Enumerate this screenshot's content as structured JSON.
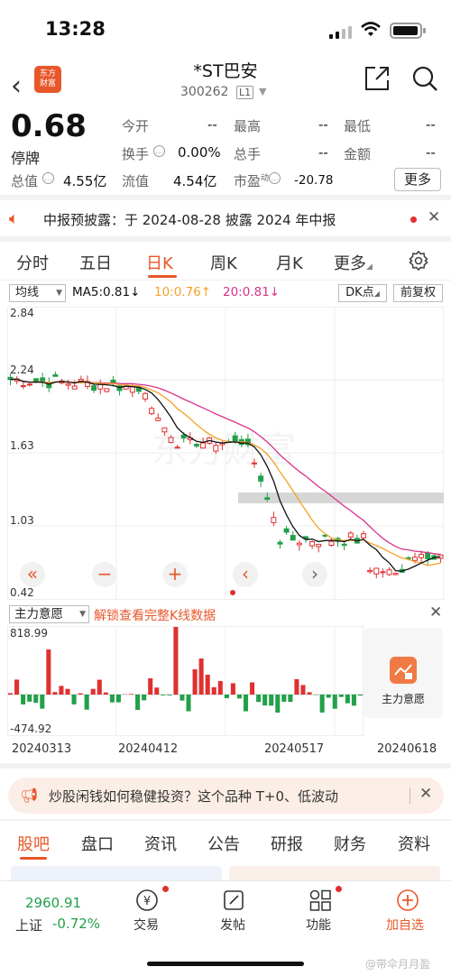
{
  "status": {
    "time": "13:28"
  },
  "header": {
    "logo": "东方\n财富",
    "title": "*ST巴安",
    "code": "300262",
    "level": "L1"
  },
  "quote": {
    "price": "0.68",
    "state": "停牌",
    "open_label": "今开",
    "open": "--",
    "high_label": "最高",
    "high": "--",
    "low_label": "最低",
    "low": "--",
    "turnover_label": "换手",
    "turnover": "0.00%",
    "volume_label": "总手",
    "volume": "--",
    "amount_label": "金额",
    "amount": "--",
    "mktcap_label": "总值",
    "mktcap": "4.55亿",
    "float_label": "流值",
    "float_cap": "4.54亿",
    "pe_label": "市盈",
    "pe_sup": "动",
    "pe": "-20.78",
    "more": "更多"
  },
  "notice": {
    "text": "中报预披露：于 2024-08-28 披露 2024 年中报"
  },
  "period_tabs": [
    "分时",
    "五日",
    "日K",
    "周K",
    "月K",
    "更多"
  ],
  "indicators": {
    "selector": "均线",
    "ma5": "MA5:0.81↓",
    "ma10": "10:0.76↑",
    "ma20": "20:0.81↓",
    "dk": "DK点",
    "adjust": "前复权",
    "colors": {
      "ma5": "#111111",
      "ma10": "#f2a227",
      "ma20": "#d9338c",
      "up": "#e03030",
      "down": "#22a04a"
    }
  },
  "price_axis": {
    "top": "2.84",
    "mid1": "2.24",
    "mid2": "1.63",
    "mid3": "1.03",
    "bottom": "0.42"
  },
  "chart_controls": [
    "«",
    "−",
    "+",
    "‹",
    "›"
  ],
  "mainforce": {
    "selector": "主力意愿",
    "unlock_link": "解锁查看完整K线数据",
    "axis_top": "818.99",
    "axis_bottom": "-474.92",
    "card_label": "主力意愿"
  },
  "dates": [
    "20240313",
    "20240412",
    "20240517",
    "20240618"
  ],
  "promo": {
    "text": "炒股闲钱如何稳健投资？这个品种 T+0、低波动"
  },
  "bottom_tabs": [
    "股吧",
    "盘口",
    "资讯",
    "公告",
    "研报",
    "财务",
    "资料"
  ],
  "tabbar": {
    "index_value": "2960.91",
    "index_name": "上证",
    "index_change": "-0.72%",
    "items": [
      "交易",
      "发帖",
      "功能",
      "加自选"
    ]
  },
  "watermark": "@带伞月月盈"
}
